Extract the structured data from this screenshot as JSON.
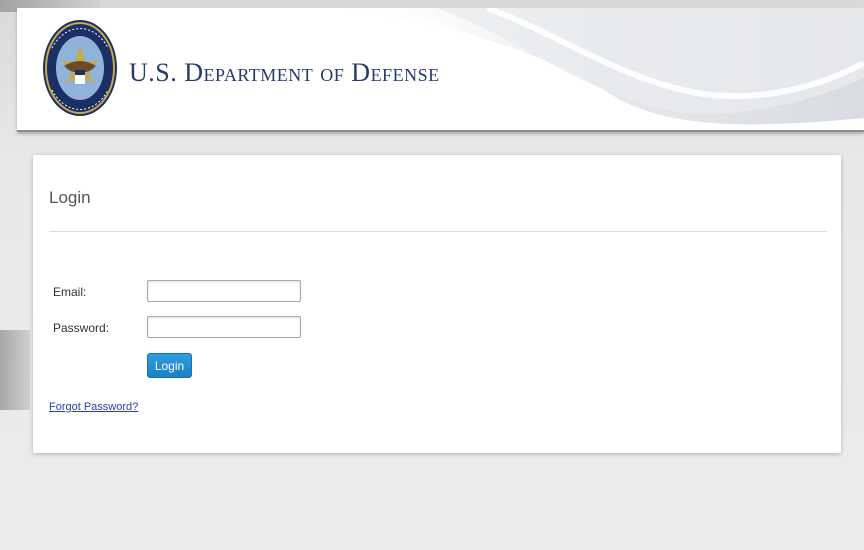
{
  "header": {
    "title": "U.S. Department of Defense",
    "seal_icon": "dod-seal-icon"
  },
  "login_card": {
    "title": "Login",
    "email_label": "Email:",
    "email_value": "",
    "password_label": "Password:",
    "password_value": "",
    "login_button_label": "Login",
    "forgot_password_label": "Forgot Password?"
  },
  "colors": {
    "title_navy": "#243b6b",
    "button_blue": "#1f8fd3",
    "link_blue": "#2a3fb0"
  }
}
